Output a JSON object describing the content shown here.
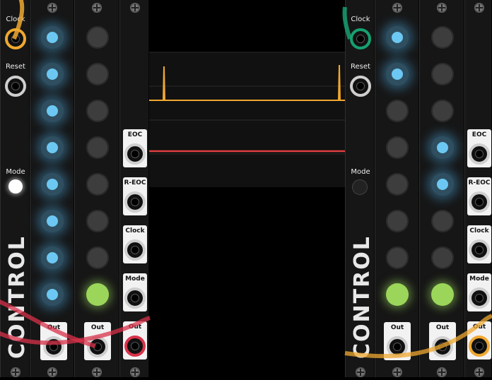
{
  "left": {
    "clock_label": "Clock",
    "reset_label": "Reset",
    "mode_label": "Mode",
    "brand": "CONTROL",
    "out_labels": [
      "Out",
      "Out",
      "Out"
    ],
    "jack_labels": [
      "EOC",
      "R-EOC",
      "Clock",
      "Mode",
      "Out"
    ],
    "col1_lamps": [
      "on",
      "on",
      "on",
      "on",
      "on",
      "on",
      "on",
      "on"
    ],
    "col2_lamps": [
      "off",
      "off",
      "off",
      "off",
      "off",
      "off",
      "off",
      "green"
    ]
  },
  "right": {
    "clock_label": "Clock",
    "reset_label": "Reset",
    "mode_label": "Mode",
    "brand": "CONTROL",
    "out_labels": [
      "Out",
      "Out",
      "Out"
    ],
    "jack_labels": [
      "EOC",
      "R-EOC",
      "Clock",
      "Mode",
      "Out"
    ],
    "col1_lamps": [
      "on",
      "on",
      "off",
      "off",
      "off",
      "off",
      "off",
      "green"
    ],
    "col2_lamps": [
      "off",
      "off",
      "off",
      "on",
      "on",
      "off",
      "off",
      "green"
    ]
  },
  "colors": {
    "cable_yellow": "#f0a830",
    "cable_red": "#d8324a",
    "cable_green": "#16a070",
    "trace_yellow": "#f0a830",
    "trace_red": "#e04040",
    "lamp_blue": "#6cc8f2",
    "lamp_green": "#9bd65a"
  }
}
